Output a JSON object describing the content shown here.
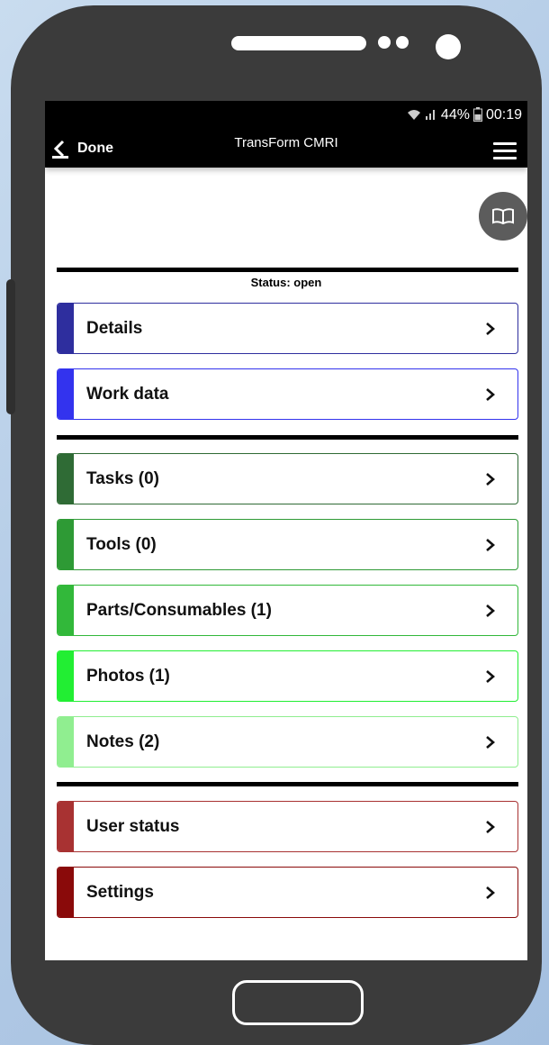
{
  "statusbar": {
    "wifi_icon": "wifi-icon",
    "signal_icon": "signal-icon",
    "battery_pct": "44%",
    "battery_icon": "battery-icon",
    "time": "00:19"
  },
  "appbar": {
    "back_label": "Done",
    "title": "TransForm CMRI",
    "menu_icon": "hamburger-menu-icon"
  },
  "manual_button_icon": "book-icon",
  "status_line": "Status: open",
  "groups": [
    {
      "items": [
        {
          "label": "Details",
          "color": "#2e2e9e"
        },
        {
          "label": "Work data",
          "color": "#3333ee"
        }
      ]
    },
    {
      "items": [
        {
          "label": "Tasks (0)",
          "color": "#2f6b35"
        },
        {
          "label": "Tools (0)",
          "color": "#2e9a35"
        },
        {
          "label": "Parts/Consumables (1)",
          "color": "#32b83a"
        },
        {
          "label": "Photos (1)",
          "color": "#22ee33"
        },
        {
          "label": "Notes (2)",
          "color": "#90ee90"
        }
      ]
    },
    {
      "items": [
        {
          "label": "User status",
          "color": "#a83232"
        },
        {
          "label": "Settings",
          "color": "#8a0a0a"
        }
      ]
    }
  ]
}
